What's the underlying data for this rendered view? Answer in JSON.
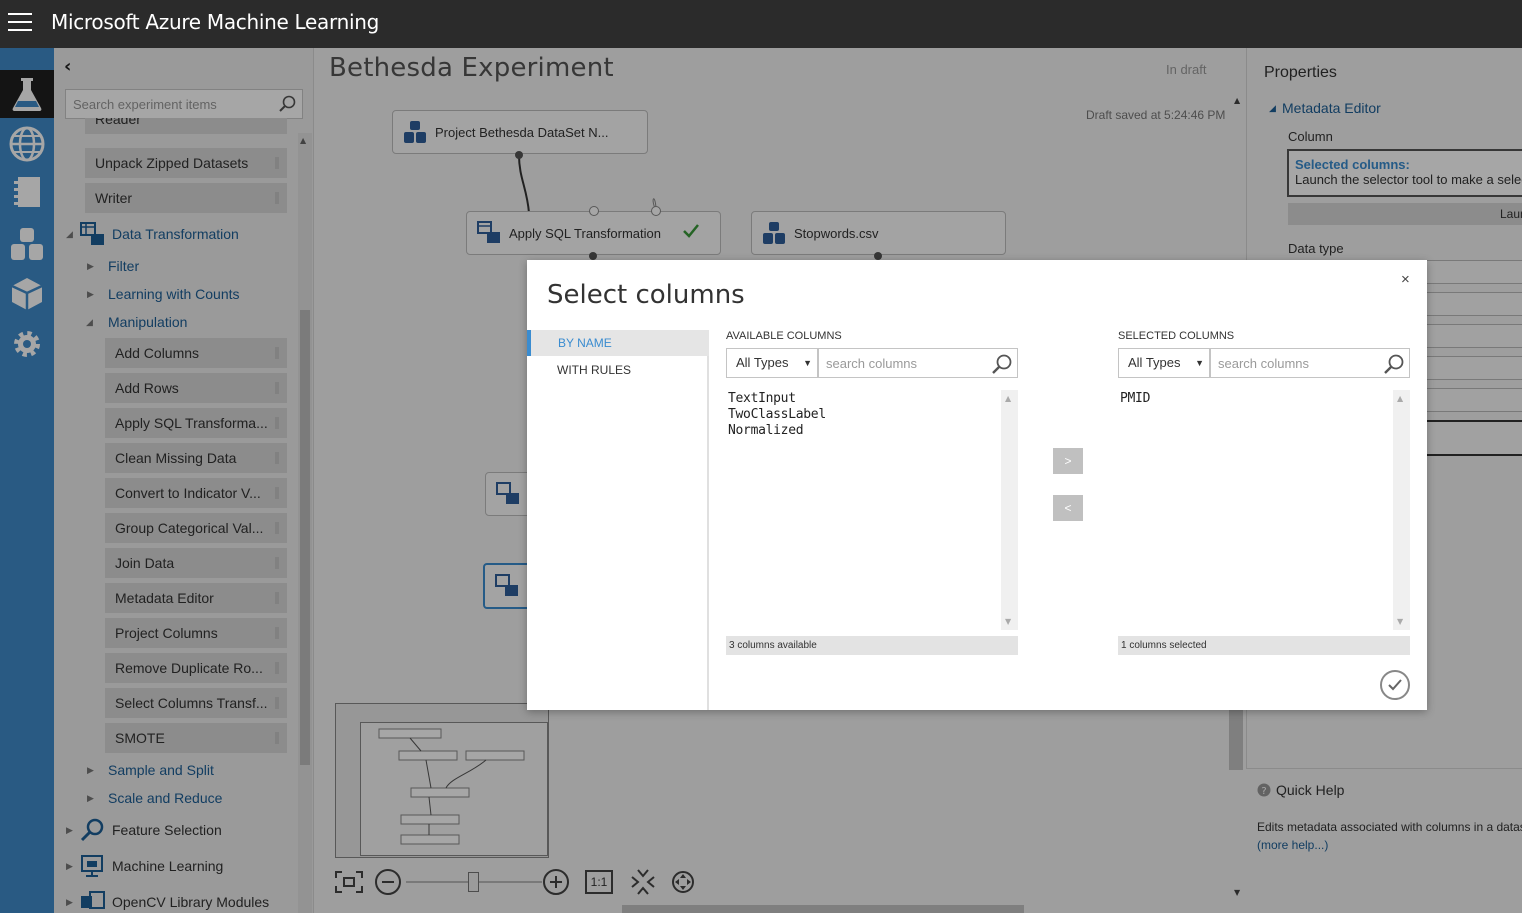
{
  "app": {
    "title": "Microsoft Azure Machine Learning"
  },
  "palette": {
    "search_placeholder": "Search experiment items",
    "items_top": [
      "Reader",
      "Unpack Zipped Datasets",
      "Writer"
    ],
    "categories": {
      "data_transformation": "Data Transformation",
      "filter": "Filter",
      "learning_with_counts": "Learning with Counts",
      "manipulation": "Manipulation",
      "sample_and_split": "Sample and Split",
      "scale_and_reduce": "Scale and Reduce",
      "feature_selection": "Feature Selection",
      "machine_learning": "Machine Learning",
      "opencv": "OpenCV Library Modules"
    },
    "manipulation_items": [
      "Add Columns",
      "Add Rows",
      "Apply SQL Transforma...",
      "Clean Missing Data",
      "Convert to Indicator V...",
      "Group Categorical Val...",
      "Join Data",
      "Metadata Editor",
      "Project Columns",
      "Remove Duplicate Ro...",
      "Select Columns Transf...",
      "SMOTE"
    ]
  },
  "canvas": {
    "title": "Bethesda Experiment",
    "status": "In draft",
    "draft_saved": "Draft saved at 5:24:46 PM",
    "nodes": {
      "dataset": "Project Bethesda DataSet N...",
      "sql": "Apply SQL Transformation",
      "stopwords": "Stopwords.csv"
    },
    "zoom_one_to_one": "1:1"
  },
  "properties": {
    "title": "Properties",
    "section": "Metadata Editor",
    "column_label": "Column",
    "selected_columns_label": "Selected columns:",
    "selected_columns_hint": "Launch the selector tool to make a selection",
    "launch_label": "Launch column selector",
    "datatype_label": "Data type"
  },
  "quick_help": {
    "title": "Quick Help",
    "text": "Edits metadata associated with columns in a dataset",
    "more": "(more help...)"
  },
  "dialog": {
    "title": "Select columns",
    "close": "×",
    "nav": {
      "by_name": "BY NAME",
      "with_rules": "WITH RULES"
    },
    "available": {
      "header": "AVAILABLE COLUMNS",
      "type": "All Types",
      "search_placeholder": "search columns",
      "items": [
        "TextInput",
        "TwoClassLabel",
        "Normalized"
      ],
      "footer": "3 columns available"
    },
    "selected": {
      "header": "SELECTED COLUMNS",
      "type": "All Types",
      "search_placeholder": "search columns",
      "items": [
        "PMID"
      ],
      "footer": "1 columns selected"
    },
    "add_button": ">",
    "remove_button": "<"
  },
  "colors": {
    "accent": "#3a8cd0",
    "rail": "#3f8bc9",
    "topbar": "#2b2b2b",
    "link": "#1c5e96"
  }
}
